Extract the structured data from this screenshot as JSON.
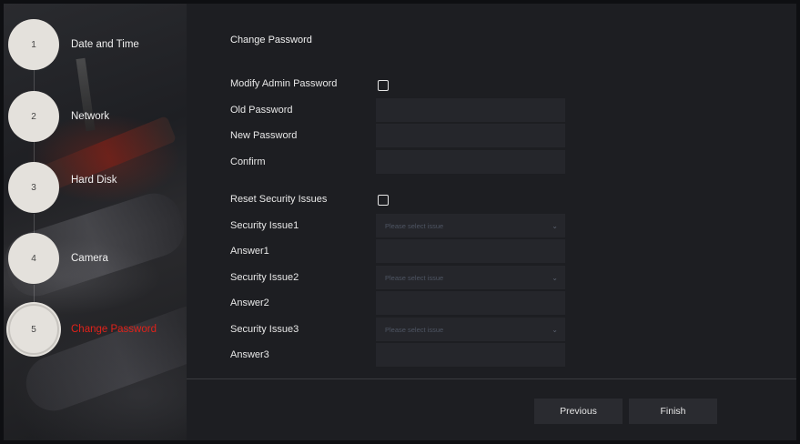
{
  "steps": [
    {
      "number": "1",
      "label": "Date and Time"
    },
    {
      "number": "2",
      "label": "Network"
    },
    {
      "number": "3",
      "label": "Hard Disk"
    },
    {
      "number": "4",
      "label": "Camera"
    },
    {
      "number": "5",
      "label": "Change Password",
      "active": true
    }
  ],
  "form": {
    "title": "Change Password",
    "modify_admin_label": "Modify Admin Password",
    "old_password_label": "Old Password",
    "new_password_label": "New Password",
    "confirm_label": "Confirm",
    "reset_security_label": "Reset Security Issues",
    "security_issue1_label": "Security Issue1",
    "answer1_label": "Answer1",
    "security_issue2_label": "Security Issue2",
    "answer2_label": "Answer2",
    "security_issue3_label": "Security Issue3",
    "answer3_label": "Answer3",
    "select_placeholder": "Please select issue"
  },
  "buttons": {
    "previous": "Previous",
    "finish": "Finish"
  },
  "colors": {
    "active_step": "#e0221a",
    "panel": "#1d1e22",
    "field": "#25262b"
  },
  "icons": {
    "select_chevron": "chevron-down-icon"
  }
}
